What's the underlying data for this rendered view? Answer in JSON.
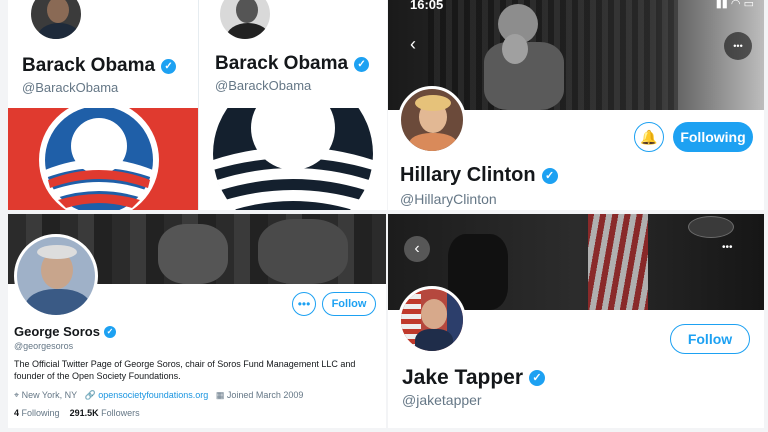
{
  "status_bar": {
    "time": "16:05"
  },
  "obama_1": {
    "name": "Barack Obama",
    "handle": "@BarackObama",
    "logo": "obama-o-logo-color"
  },
  "obama_2": {
    "name": "Barack Obama",
    "handle": "@BarackObama",
    "logo": "obama-o-logo-mono"
  },
  "clinton": {
    "name": "Hillary Clinton",
    "handle": "@HillaryClinton",
    "follow_state": "Following"
  },
  "soros": {
    "name": "George Soros",
    "handle": "@georgesoros",
    "bio": "The Official Twitter Page of George Soros, chair of Soros Fund Management LLC and founder of the Open Society Foundations.",
    "location": "New York, NY",
    "website": "opensocietyfoundations.org",
    "joined": "Joined March 2009",
    "following_count": "4",
    "following_label": "Following",
    "followers_count": "291.5K",
    "followers_label": "Followers",
    "follow_label": "Follow"
  },
  "tapper": {
    "name": "Jake Tapper",
    "handle": "@jaketapper",
    "follow_label": "Follow"
  },
  "colors": {
    "accent": "#1da1f2",
    "obama_red": "#e03a2f",
    "obama_blue": "#1f5fa8"
  }
}
